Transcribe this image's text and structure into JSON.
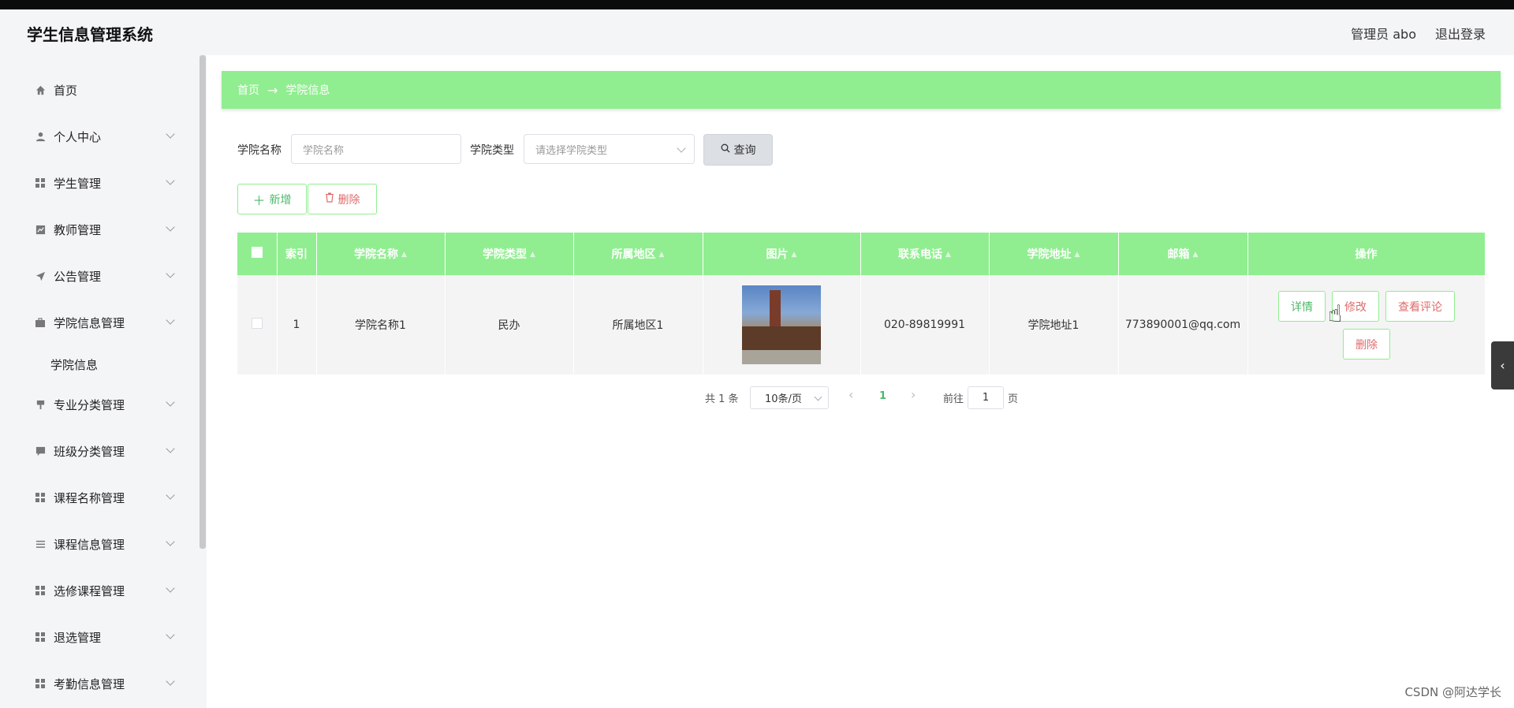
{
  "app": {
    "title": "学生信息管理系统"
  },
  "header": {
    "user": "管理员 abo",
    "logout": "退出登录"
  },
  "sidebar": {
    "items": [
      {
        "label": "首页",
        "icon": "home-icon"
      },
      {
        "label": "个人中心",
        "icon": "user-icon"
      },
      {
        "label": "学生管理",
        "icon": "grid-icon"
      },
      {
        "label": "教师管理",
        "icon": "chart-icon"
      },
      {
        "label": "公告管理",
        "icon": "send-icon"
      },
      {
        "label": "学院信息管理",
        "icon": "briefcase-icon"
      },
      {
        "label": "专业分类管理",
        "icon": "flag-icon"
      },
      {
        "label": "班级分类管理",
        "icon": "comment-icon"
      },
      {
        "label": "课程名称管理",
        "icon": "grid-icon"
      },
      {
        "label": "课程信息管理",
        "icon": "menu-icon"
      },
      {
        "label": "选修课程管理",
        "icon": "grid-icon"
      },
      {
        "label": "退选管理",
        "icon": "grid-icon"
      },
      {
        "label": "考勤信息管理",
        "icon": "grid-icon"
      }
    ],
    "sub_item": "学院信息"
  },
  "breadcrumb": {
    "home": "首页",
    "arrow": "→",
    "current": "学院信息"
  },
  "search": {
    "name_label": "学院名称",
    "name_placeholder": "学院名称",
    "type_label": "学院类型",
    "type_placeholder": "请选择学院类型",
    "query_label": "查询"
  },
  "actions": {
    "add": "新增",
    "delete": "删除"
  },
  "table": {
    "headers": [
      "索引",
      "学院名称",
      "学院类型",
      "所属地区",
      "图片",
      "联系电话",
      "学院地址",
      "邮箱",
      "操作"
    ],
    "rows": [
      {
        "index": "1",
        "name": "学院名称1",
        "type": "民办",
        "region": "所属地区1",
        "phone": "020-89819991",
        "address": "学院地址1",
        "email": "773890001@qq.com"
      }
    ],
    "row_actions": {
      "detail": "详情",
      "edit": "修改",
      "comments": "查看评论",
      "delete": "删除"
    }
  },
  "pagination": {
    "total": "共 1 条",
    "page_size": "10条/页",
    "current_page": "1",
    "goto_prefix": "前往",
    "goto_value": "1",
    "goto_suffix": "页"
  },
  "watermark": "CSDN @阿达学长",
  "colors": {
    "accent": "#90ee90",
    "danger": "#e06b6b",
    "success_text": "#4db86a"
  }
}
